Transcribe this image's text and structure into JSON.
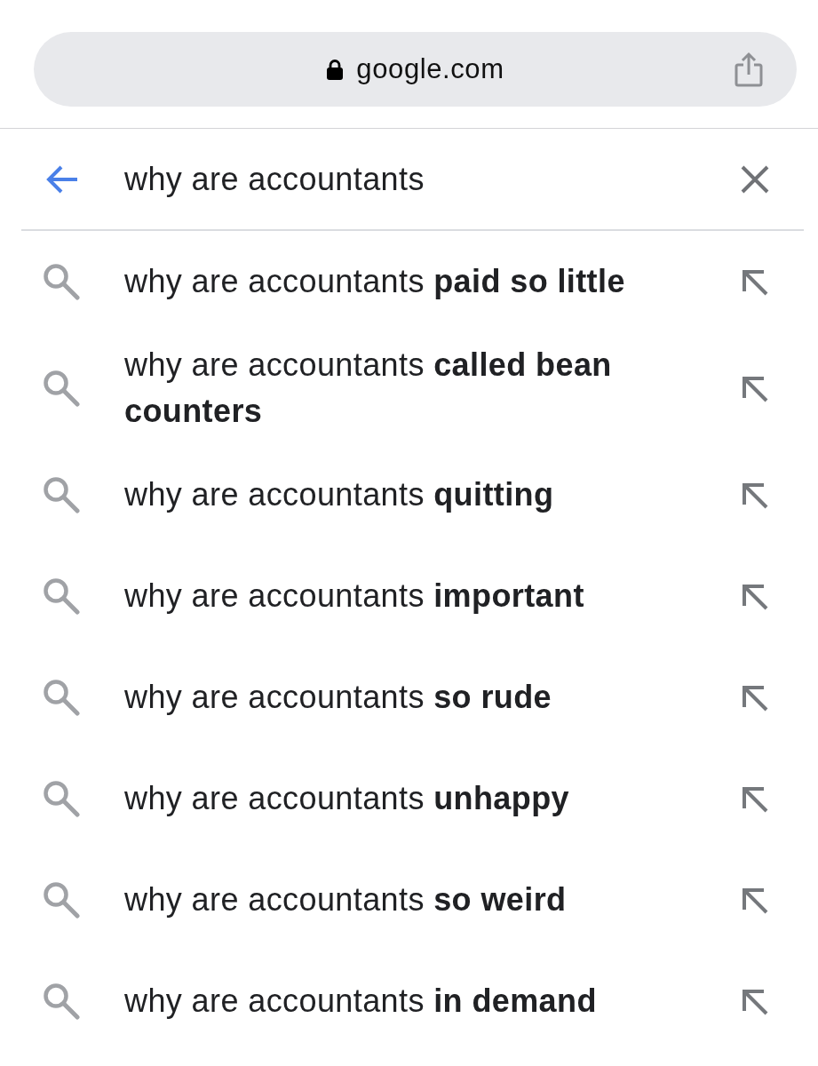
{
  "address_bar": {
    "domain": "google.com"
  },
  "search": {
    "value": "why are accountants"
  },
  "suggestions": [
    {
      "text": "why are accountants **paid so little**"
    },
    {
      "text": "why are accountants **called bean counters**"
    },
    {
      "text": "why are accountants **quitting**"
    },
    {
      "text": "why are accountants **important**"
    },
    {
      "text": "why are accountants **so rude**"
    },
    {
      "text": "why are accountants **unhappy**"
    },
    {
      "text": "why are accountants **so weird**"
    },
    {
      "text": "why are accountants **in demand**"
    }
  ]
}
